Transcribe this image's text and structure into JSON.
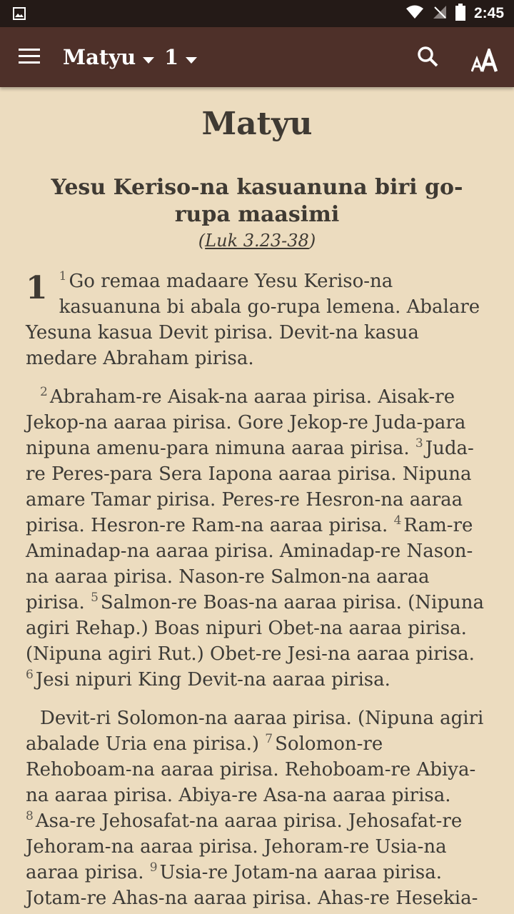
{
  "status_bar": {
    "time": "2:45"
  },
  "toolbar": {
    "book": "Matyu",
    "chapter": "1"
  },
  "content": {
    "book_title": "Matyu",
    "section_heading": "Yesu Keriso-na kasuanuna biri go-rupa maasimi",
    "crossref_open": "(",
    "crossref_link": "Luk 3.23-38",
    "crossref_close": ")",
    "chapter_number": "1",
    "paragraphs": [
      {
        "verses": [
          {
            "num": "1",
            "text": "Go remaa madaare Yesu Keriso-na kasuanuna bi abala go-rupa lemena. Abalare Yesuna kasua Devit pirisa. Devit-na kasua medare Abraham pirisa."
          }
        ]
      },
      {
        "verses": [
          {
            "num": "2",
            "text": "Abraham-re Aisak-na aaraa pirisa. Aisak-re Jekop-na aaraa pirisa. Gore Jekop-re Juda-para nipuna amenu-para nimuna aaraa pirisa. "
          },
          {
            "num": "3",
            "text": "Juda-re Peres-para Sera Iapona aaraa pirisa. Nipuna amare Tamar pirisa. Peres-re Hesron-na aaraa pirisa. Hesron-re Ram-na aaraa pirisa. "
          },
          {
            "num": "4",
            "text": "Ram-re Aminadap-na aaraa pirisa. Aminadap-re Nason-na aaraa pirisa. Nason-re Salmon-na aaraa pirisa. "
          },
          {
            "num": "5",
            "text": "Salmon-re Boas-na aaraa pirisa. (Nipuna agiri Rehap.) Boas nipuri Obet-na aaraa pirisa. (Nipuna agiri Rut.) Obet-re Jesi-na aaraa pirisa. "
          },
          {
            "num": "6",
            "text": "Jesi nipuri King Devit-na aaraa pirisa."
          }
        ]
      },
      {
        "verses": [
          {
            "num": "",
            "text": "Devit-ri Solomon-na aaraa pirisa. (Nipuna agiri abalade Uria ena pirisa.) "
          },
          {
            "num": "7",
            "text": "Solomon-re Rehoboam-na aaraa pirisa. Rehoboam-re Abiya-na aaraa pirisa. Abiya-re Asa-na aaraa pirisa. "
          },
          {
            "num": "8",
            "text": "Asa-re Jehosafat-na aaraa pirisa. Jehosafat-re Jehoram-na aaraa pirisa. Jehoram-re Usia-na aaraa pirisa. "
          },
          {
            "num": "9",
            "text": "Usia-re Jotam-na aaraa pirisa. Jotam-re Ahas-na aaraa pirisa. Ahas-re Hesekia-"
          }
        ]
      }
    ]
  }
}
